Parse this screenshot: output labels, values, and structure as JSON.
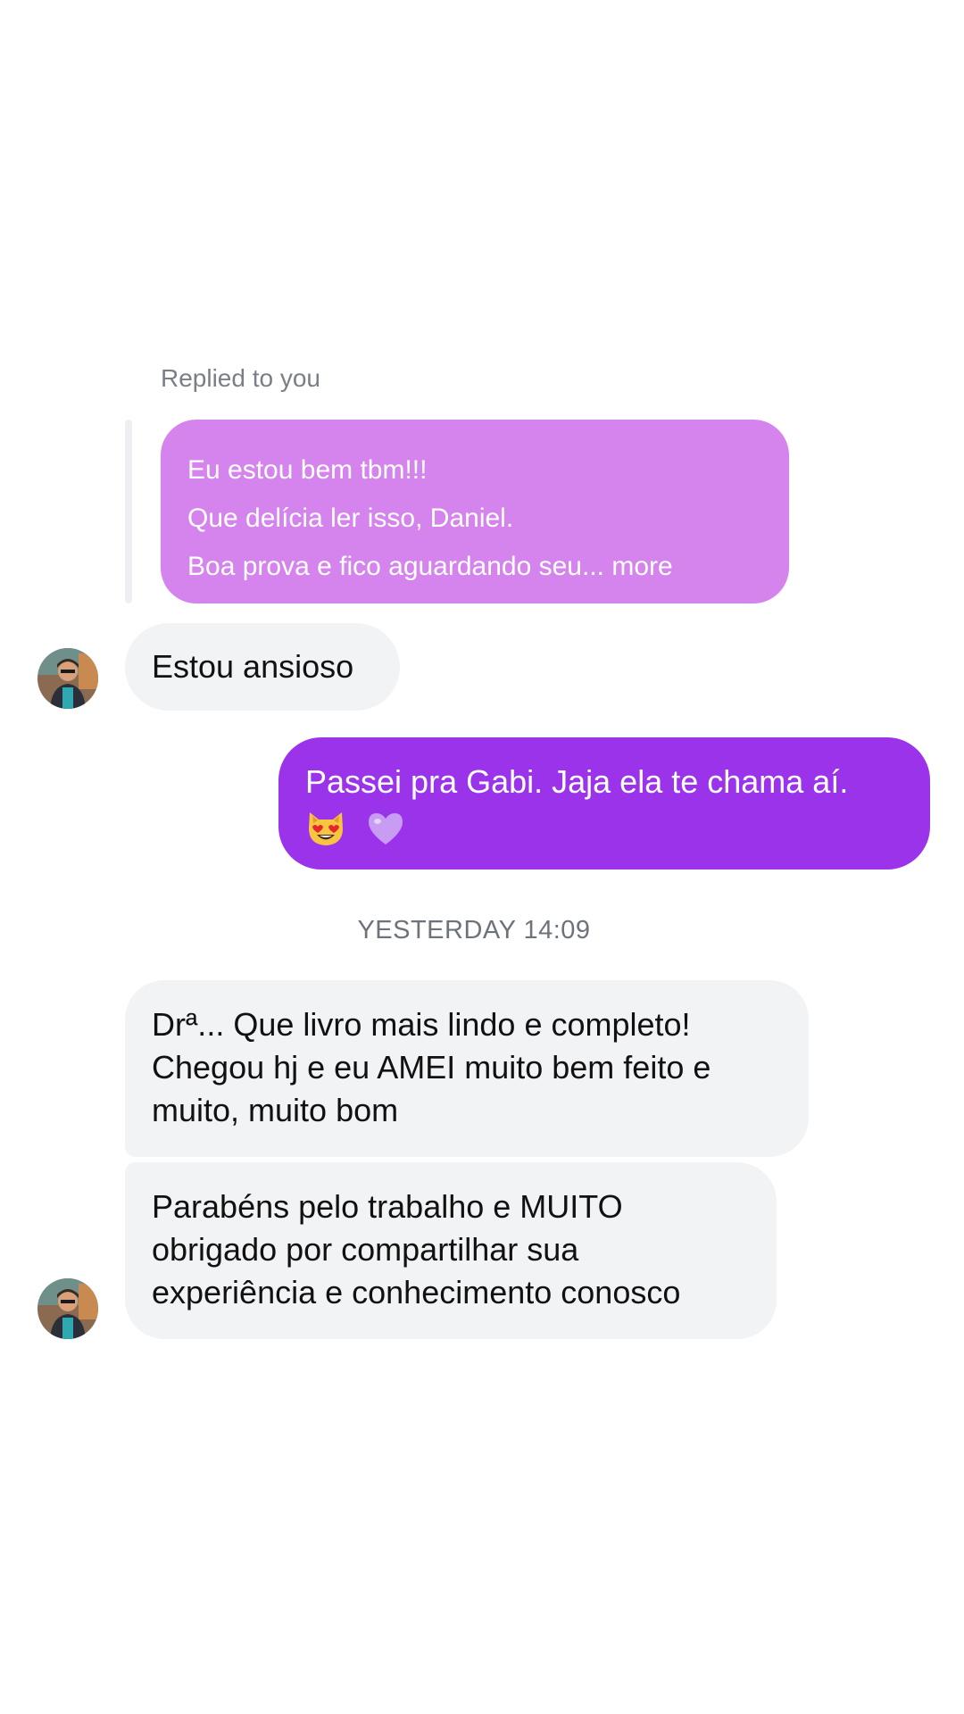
{
  "reply": {
    "label": "Replied to you",
    "lines": [
      "Eu estou bem tbm!!!",
      "Que delícia ler isso, Daniel.",
      "Boa prova e fico aguardando seu... more"
    ]
  },
  "messages": {
    "incoming_1": "Estou ansioso",
    "outgoing_1": {
      "text": "Passei pra Gabi. Jaja ela te chama aí.",
      "emojis": [
        "heart-eyes-cat-emoji",
        "purple-heart-emoji"
      ]
    },
    "timestamp": "YESTERDAY 14:09",
    "incoming_2": {
      "lines": [
        "Drª... Que livro mais lindo e completo!",
        "Chegou hj e eu AMEI muito bem feito e",
        "muito, muito bom"
      ]
    },
    "incoming_3": {
      "lines": [
        "Parabéns pelo trabalho e MUITO",
        "obrigado por compartilhar sua",
        "experiência e conhecimento conosco"
      ]
    }
  },
  "colors": {
    "reply_bubble": "#d484ec",
    "outgoing_bubble": "#9a33ea",
    "incoming_bubble": "#f2f3f5"
  }
}
